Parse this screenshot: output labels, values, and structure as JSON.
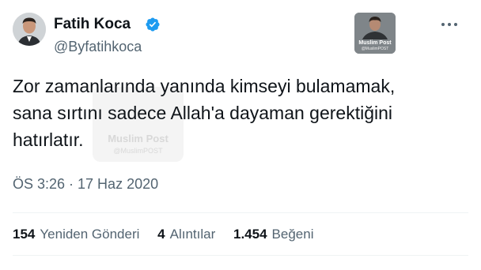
{
  "author": {
    "display_name": "Fatih Koca",
    "handle": "@Byfatihkoca",
    "verified": true
  },
  "watermark": {
    "title": "Muslim Post",
    "subtitle": "@MuslimPOST"
  },
  "tweet": {
    "lines": [
      "Zor zamanlarında yanında kimseyi bulamamak,",
      "sana sırtını sadece Allah'a dayaman gerektiğini",
      "hatırlatır."
    ],
    "timestamp": "ÖS 3:26 · 17 Haz 2020"
  },
  "stats": {
    "retweets": {
      "count": "154",
      "label": "Yeniden Gönderi"
    },
    "quotes": {
      "count": "4",
      "label": "Alıntılar"
    },
    "likes": {
      "count": "1.454",
      "label": "Beğeni"
    }
  },
  "icons": {
    "verified": "verified-badge-icon",
    "more": "more-options-icon"
  },
  "colors": {
    "verified_blue": "#1d9bf0",
    "secondary_text": "#536471",
    "primary_text": "#0f1419"
  }
}
